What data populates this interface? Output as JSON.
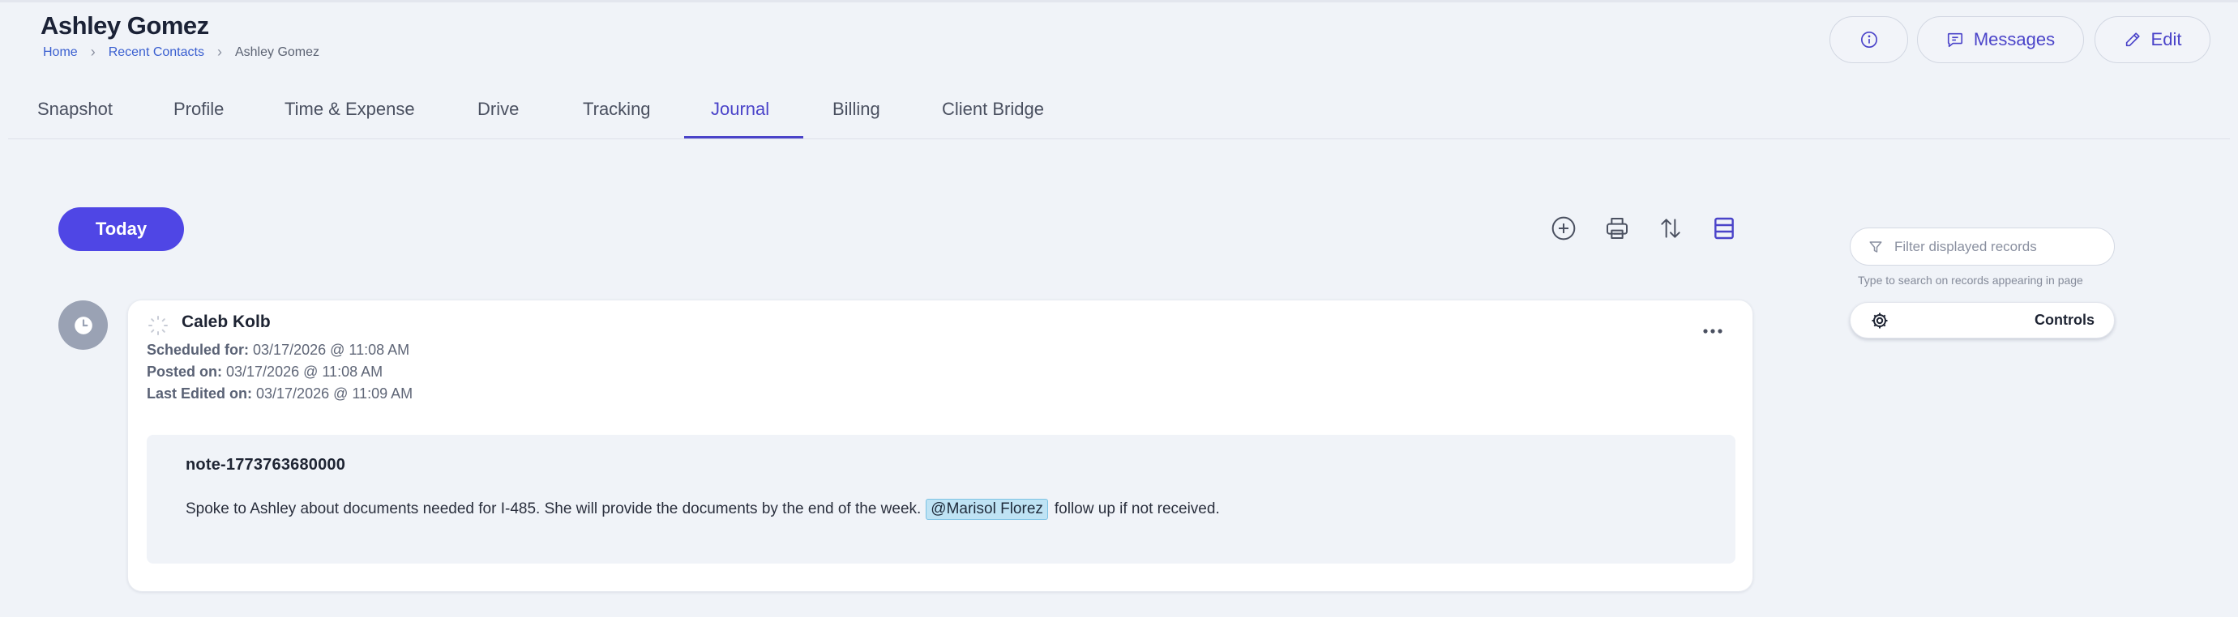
{
  "header": {
    "title": "Ashley Gomez",
    "breadcrumb": [
      "Home",
      "Recent Contacts",
      "Ashley Gomez"
    ],
    "buttons": {
      "messages_label": "Messages",
      "edit_label": "Edit"
    }
  },
  "tabs": [
    {
      "label": "Snapshot"
    },
    {
      "label": "Profile"
    },
    {
      "label": "Time & Expense"
    },
    {
      "label": "Drive"
    },
    {
      "label": "Tracking"
    },
    {
      "label": "Journal",
      "active": true
    },
    {
      "label": "Billing"
    },
    {
      "label": "Client Bridge"
    }
  ],
  "toolbar": {
    "today_label": "Today",
    "icons": [
      "plus-circle-icon",
      "printer-icon",
      "sort-arrows-icon",
      "layout-rows-icon"
    ]
  },
  "entry": {
    "author": "Caleb Kolb",
    "scheduled_label": "Scheduled for:",
    "scheduled_value": "03/17/2026 @ 11:08 AM",
    "posted_label": "Posted on:",
    "posted_value": "03/17/2026 @ 11:08 AM",
    "edited_label": "Last Edited on:",
    "edited_value": "03/17/2026 @ 11:09 AM",
    "note": {
      "title": "note-1773763680000",
      "text_before": "Spoke to Ashley about documents needed for I-485. She will provide the documents by the end of the week.",
      "mention": "@Marisol Florez",
      "text_after": "follow up if not received."
    }
  },
  "sidebar": {
    "filter_placeholder": "Filter displayed records",
    "filter_value": "",
    "filter_hint": "Type to search on records appearing in page",
    "controls_label": "Controls"
  },
  "colors": {
    "accent": "#4f46e5",
    "accent_text": "#4a43c9",
    "background": "#f0f3f8",
    "mention_bg": "#bfe3f4",
    "avatar_bg": "#9aa2b4"
  }
}
